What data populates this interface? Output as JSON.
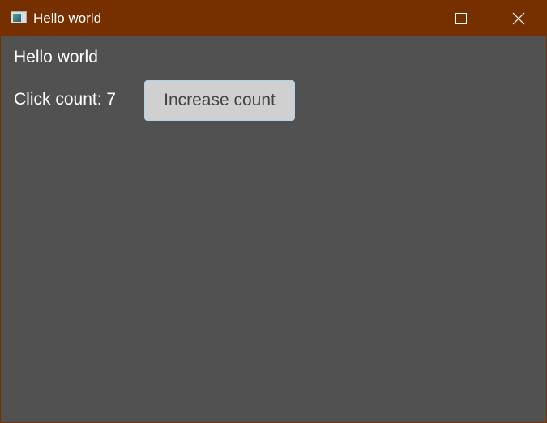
{
  "window": {
    "title": "Hello world"
  },
  "main": {
    "heading": "Hello world",
    "count_label": "Click count: 7",
    "count": 7,
    "button_label": "Increase count"
  },
  "colors": {
    "titlebar": "#763000",
    "background": "#515151",
    "button": "#d0d0d0"
  }
}
